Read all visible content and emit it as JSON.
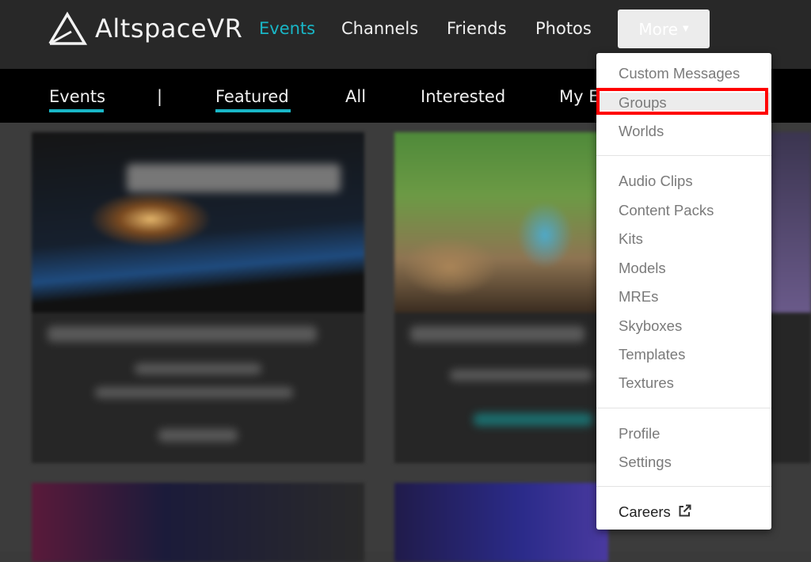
{
  "brand": {
    "name": "AltspaceVR"
  },
  "nav": {
    "items": [
      "Events",
      "Channels",
      "Friends",
      "Photos"
    ],
    "more_label": "More"
  },
  "subnav": {
    "items": [
      "Events",
      "|",
      "Featured",
      "All",
      "Interested",
      "My E"
    ]
  },
  "dropdown": {
    "groups": [
      [
        "Custom Messages",
        "Groups",
        "Worlds"
      ],
      [
        "Audio Clips",
        "Content Packs",
        "Kits",
        "Models",
        "MREs",
        "Skyboxes",
        "Templates",
        "Textures"
      ],
      [
        "Profile",
        "Settings"
      ],
      [
        "Careers"
      ]
    ],
    "external_icon": "external-link-icon"
  },
  "colors": {
    "accent": "#19b6c6",
    "highlight_box": "#ff0000"
  }
}
